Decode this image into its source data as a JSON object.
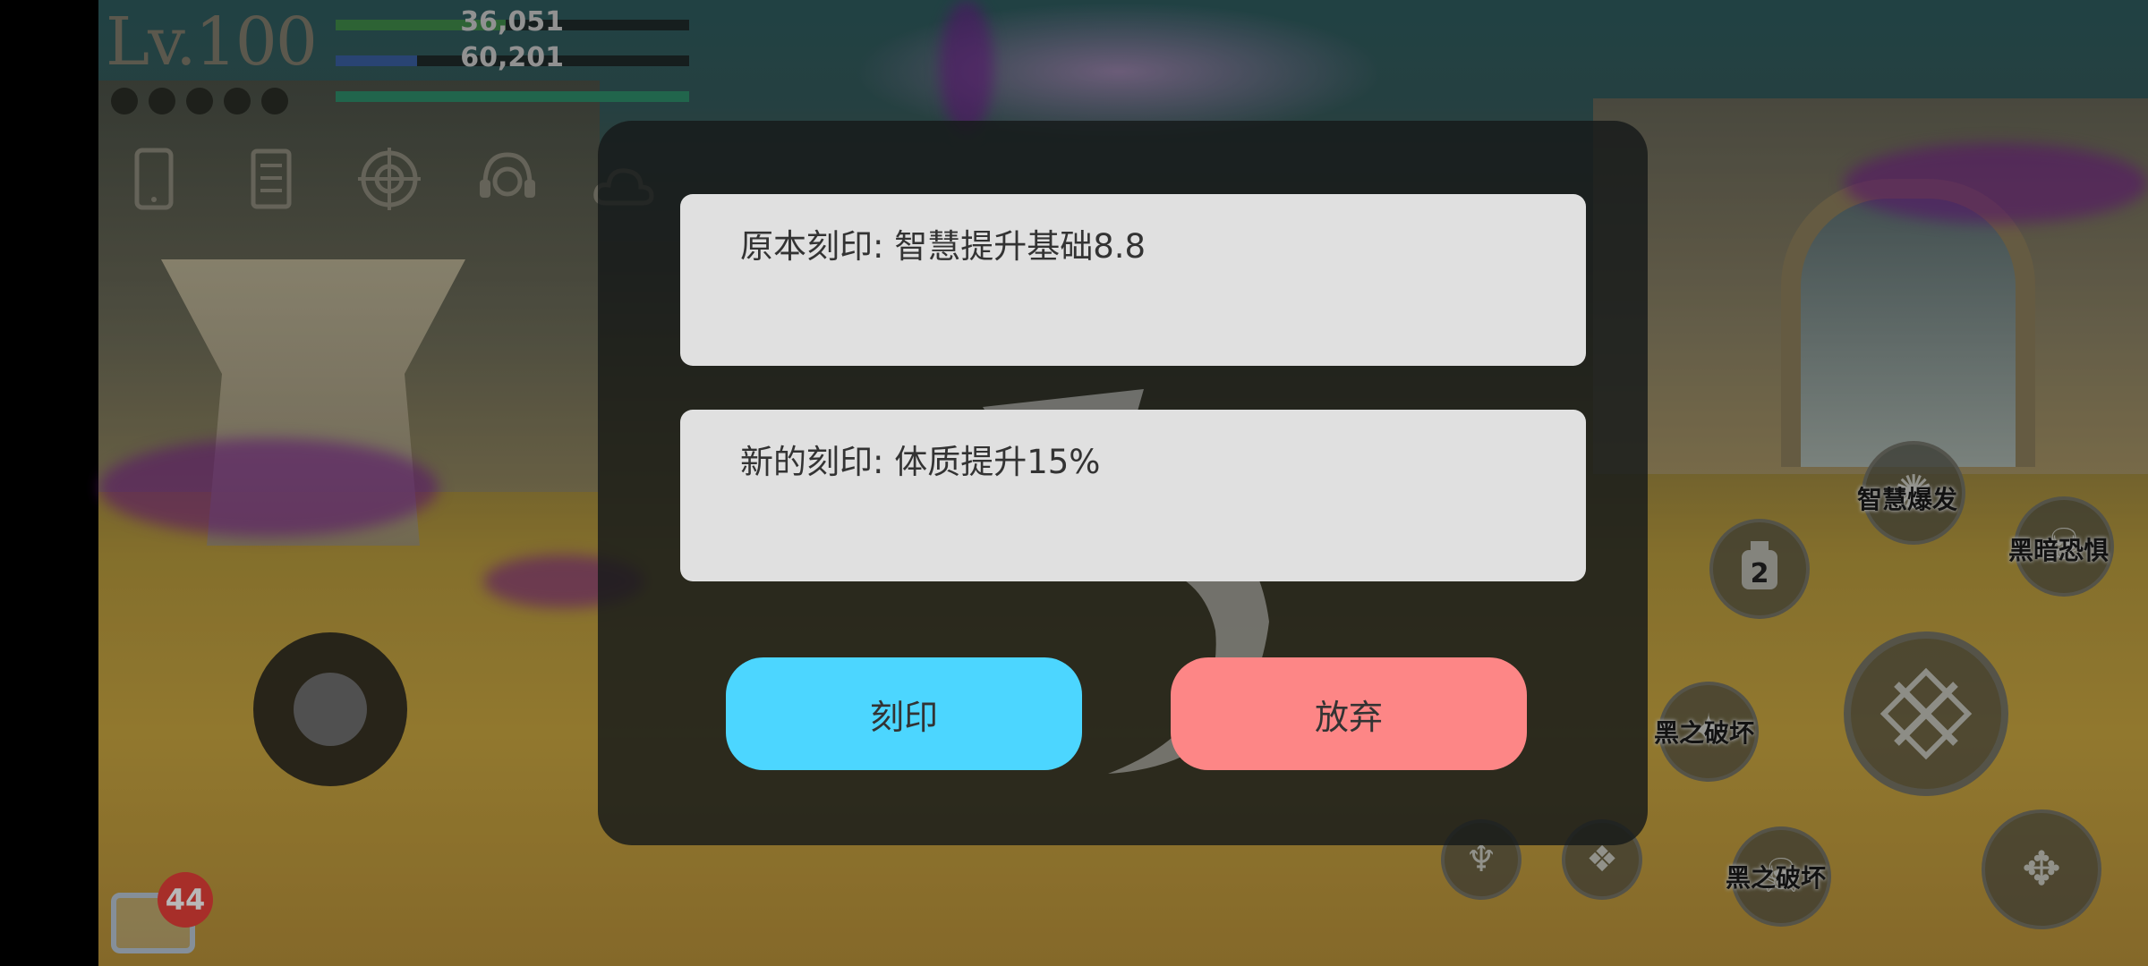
{
  "hud": {
    "level_label": "Lv.100",
    "hp_value": "36,051",
    "mp_value": "60,201",
    "hp_fraction": 0.48,
    "mp_fraction": 0.23,
    "xp_fraction": 1.0,
    "bar_colors": {
      "hp": "#3f8a48",
      "mp": "#3a5fa0",
      "xp": "#2f8d6a"
    },
    "menu_icons": [
      "phone-icon",
      "scroll-icon",
      "target-icon",
      "headset-icon",
      "cloud-icon"
    ]
  },
  "chat": {
    "badge_count": "44"
  },
  "dialog": {
    "original_label": "原本刻印: 智慧提升基础8.8",
    "new_label": "新的刻印: 体质提升15%",
    "engrave_button": "刻印",
    "abandon_button": "放弃",
    "colors": {
      "engrave": "#4cd6ff",
      "abandon": "#fd8686",
      "box": "#e0e0e0"
    }
  },
  "skills": {
    "wisdom_burst": "智慧爆发",
    "dark_fear": "黑暗恐惧",
    "slot_number": "2",
    "dark_destroy_1": "黑之破坏",
    "dark_destroy_2": "黑之破坏"
  }
}
